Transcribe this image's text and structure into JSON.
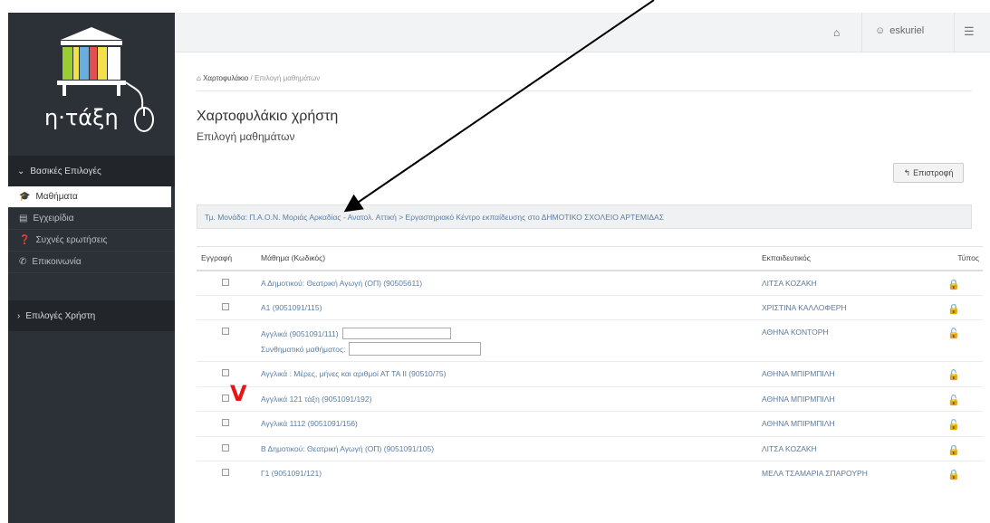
{
  "logo": {
    "text": "η·τάξη"
  },
  "sidebar": {
    "section_main": "Βασικές Επιλογές",
    "items": [
      {
        "label": "Μαθήματα",
        "icon": "graduation-cap-icon",
        "active": true
      },
      {
        "label": "Εγχειρίδια",
        "icon": "book-icon",
        "active": false
      },
      {
        "label": "Συχνές ερωτήσεις",
        "icon": "question-icon",
        "active": false
      },
      {
        "label": "Επικοινωνία",
        "icon": "phone-icon",
        "active": false
      }
    ],
    "section_user": "Επιλογές Χρήστη"
  },
  "topbar": {
    "home_icon": "home-icon",
    "username": "eskuriel",
    "user_icon": "user-avatar-icon",
    "menu_icon": "menu-icon"
  },
  "breadcrumb": {
    "item1": "Χαρτοφυλάκιο",
    "separator": "/",
    "item2": "Επιλογή μαθημάτων"
  },
  "page": {
    "title": "Χαρτοφυλάκιο χρήστη",
    "subtitle": "Επιλογή μαθημάτων",
    "back_button": "Επιστροφή",
    "info_text": "Τμ. Μονάδα: Π.Α.Ο.Ν. Μοριάς Αρκαδίας - Ανατολ. Αττική > Εργαστηριακό Κέντρο εκπαίδευσης στο ΔΗΜΟΤΙΚΟ ΣΧΟΛΕΙΟ ΑΡΤΕΜΙΔΑΣ"
  },
  "table": {
    "headers": {
      "register": "Εγγραφή",
      "course": "Μάθημα (Κωδικός)",
      "instructors": "Εκπαιδευτικός",
      "type": "Τύπος"
    },
    "rows": [
      {
        "course": "Α Δημοτικού: Θεατρική Αγωγή (ΟΠ) (90505611)",
        "instructor": "ΛΙΤΣΑ ΚΟΖΑΚΗ",
        "type": "locked"
      },
      {
        "course": "Α1 (9051091/115)",
        "instructor": "ΧΡΙΣΤΙΝΑ ΚΑΛΛΟΦΕΡΗ",
        "type": "locked"
      },
      {
        "course": "Αγγλικά (9051091/111)",
        "password_label": "Συνθηματικό μαθήματος:",
        "instructor": "ΑΘΗΝΑ ΚΟΝΤΟΡΗ",
        "type": "open"
      },
      {
        "course": "Αγγλικά : Μέρες, μήνες και αριθμοί ΑΤ ΤΑ ΙΙ (90510/75)",
        "instructor": "ΑΘΗΝΑ ΜΠΙΡΜΠΙΛΗ",
        "type": "open"
      },
      {
        "course": "Αγγλικά 121 τάξη (9051091/192)",
        "instructor": "ΑΘΗΝΑ ΜΠΙΡΜΠΙΛΗ",
        "type": "open"
      },
      {
        "course": "Αγγλικά 1112 (9051091/156)",
        "instructor": "ΑΘΗΝΑ ΜΠΙΡΜΠΙΛΗ",
        "type": "open"
      },
      {
        "course": "Β Δημοτικού: Θεατρική Αγωγή (ΟΠ) (9051091/105)",
        "instructor": "ΛΙΤΣΑ ΚΟΖΑΚΗ",
        "type": "locked"
      },
      {
        "course": "Γ1 (9051091/121)",
        "instructor": "ΜΕΛΑ ΤΣΑΜΑΡΙΑ ΣΠΑΡΟΥΡΗ",
        "type": "locked"
      }
    ]
  },
  "annotation": {
    "mark": "V",
    "color": "#e01818"
  }
}
